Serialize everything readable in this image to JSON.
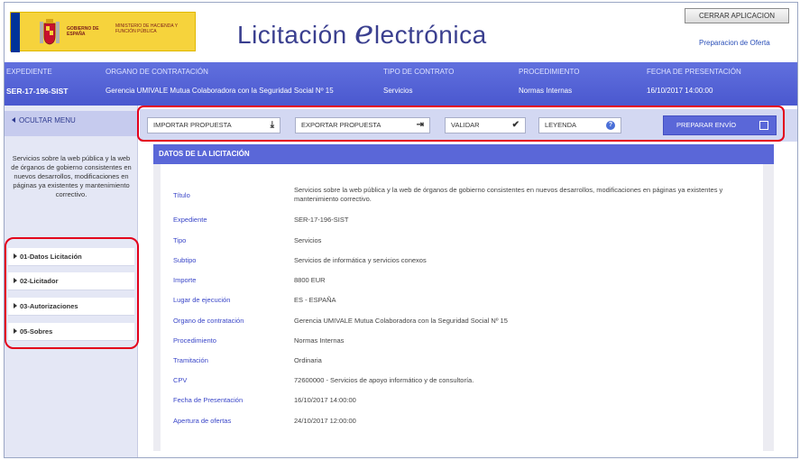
{
  "header": {
    "logo_gov": "GOBIERNO DE ESPAÑA",
    "logo_ministry": "MINISTERIO DE HACIENDA Y FUNCIÓN PÚBLICA",
    "title_start": "Licitación ",
    "title_e": "e",
    "title_end": "lectrónica",
    "close_button": "CERRAR APLICACION",
    "prep_link": "Preparacion de Oferta"
  },
  "info_band": {
    "labels": [
      "EXPEDIENTE",
      "ORGANO DE CONTRATACIÓN",
      "TIPO DE CONTRATO",
      "PROCEDIMIENTO",
      "FECHA DE PRESENTACIÓN"
    ],
    "values": [
      "SER-17-196-SIST",
      "Gerencia UMIVALE Mutua Colaboradora con la Seguridad Social Nº 15",
      "Servicios",
      "Normas Internas",
      "16/10/2017 14:00:00"
    ]
  },
  "sidebar": {
    "hide_menu": "OCULTAR MENU",
    "description": "Servicios sobre la web pública y la web de órganos de gobierno consistentes en nuevos desarrollos, modificaciones en páginas ya existentes y mantenimiento correctivo.",
    "items": [
      {
        "label": "01-Datos Licitación"
      },
      {
        "label": "02-Licitador"
      },
      {
        "label": "03-Autorizaciones"
      },
      {
        "label": "05-Sobres"
      }
    ]
  },
  "toolbar": {
    "import_label": "IMPORTAR PROPUESTA",
    "export_label": "EXPORTAR PROPUESTA",
    "validate_label": "VALIDAR",
    "legend_label": "LEYENDA",
    "send_label": "PREPARAR ENVÍO"
  },
  "main": {
    "section_title": "DATOS DE LA LICITACIÓN",
    "rows": [
      {
        "label": "Título",
        "value": "Servicios sobre la web pública y la web de órganos de gobierno consistentes en nuevos desarrollos, modificaciones en páginas ya existentes y mantenimiento correctivo."
      },
      {
        "label": "Expediente",
        "value": "SER-17-196-SIST"
      },
      {
        "label": "Tipo",
        "value": "Servicios"
      },
      {
        "label": "Subtipo",
        "value": "Servicios de informática y servicios conexos"
      },
      {
        "label": "Importe",
        "value": "8800 EUR"
      },
      {
        "label": "Lugar de ejecución",
        "value": "ES - ESPAÑA"
      },
      {
        "label": "Organo de contratación",
        "value": "Gerencia UMIVALE Mutua Colaboradora con la Seguridad Social Nº 15"
      },
      {
        "label": "Procedimiento",
        "value": "Normas Internas"
      },
      {
        "label": "Tramitación",
        "value": "Ordinaria"
      },
      {
        "label": "CPV",
        "value": "72600000 - Servicios de apoyo informático y de consultoría."
      },
      {
        "label": "Fecha de Presentación",
        "value": "16/10/2017 14:00:00"
      },
      {
        "label": "Apertura de ofertas",
        "value": "24/10/2017 12:00:00"
      }
    ]
  },
  "colors": {
    "band": "#5360d6",
    "label_blue": "#3a46c8",
    "highlight_red": "#e3001b"
  }
}
